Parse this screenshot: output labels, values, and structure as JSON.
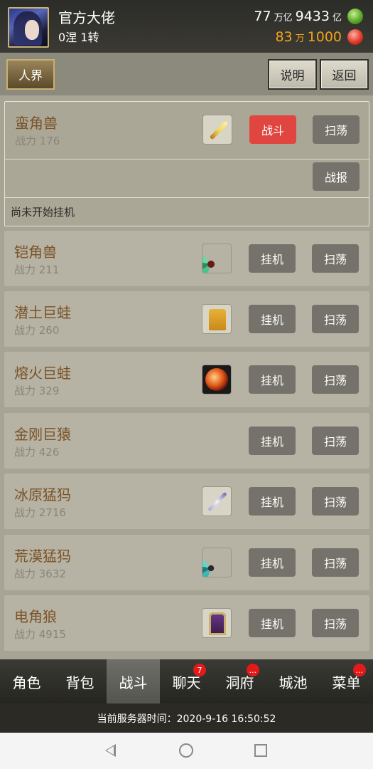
{
  "header": {
    "player_name": "官方大佬",
    "player_level": "0涅 1转",
    "currency_primary": {
      "amount_a": "77",
      "unit_a": "万亿",
      "amount_b": "9433",
      "unit_b": "亿",
      "gem": "green-gem-icon"
    },
    "currency_secondary": {
      "amount_a": "83",
      "unit_a": "万",
      "amount_b": "1000",
      "gem": "red-gem-icon"
    }
  },
  "toolbar": {
    "realm": "人界",
    "explain": "说明",
    "back": "返回"
  },
  "active_card": {
    "name": "蛮角兽",
    "power": "战力 176",
    "icon": "golden-sword-icon",
    "fight_label": "战斗",
    "sweep_label": "扫荡",
    "report_label": "战报",
    "status": "尚未开始挂机"
  },
  "monsters": [
    {
      "name": "铠角兽",
      "power": "战力 211",
      "icon": "green-fan-icon",
      "idle_label": "挂机",
      "sweep_label": "扫荡"
    },
    {
      "name": "潜土巨蛙",
      "power": "战力 260",
      "icon": "yellow-robe-icon",
      "idle_label": "挂机",
      "sweep_label": "扫荡"
    },
    {
      "name": "熔火巨蛙",
      "power": "战力 329",
      "icon": "fire-orb-icon",
      "idle_label": "挂机",
      "sweep_label": "扫荡"
    },
    {
      "name": "金刚巨猿",
      "power": "战力 426",
      "icon": "",
      "idle_label": "挂机",
      "sweep_label": "扫荡"
    },
    {
      "name": "冰原猛犸",
      "power": "战力 2716",
      "icon": "silver-blade-icon",
      "idle_label": "挂机",
      "sweep_label": "扫荡"
    },
    {
      "name": "荒漠猛犸",
      "power": "战力 3632",
      "icon": "teal-fan-icon",
      "idle_label": "挂机",
      "sweep_label": "扫荡"
    },
    {
      "name": "电角狼",
      "power": "战力 4915",
      "icon": "purple-armor-icon",
      "idle_label": "挂机",
      "sweep_label": "扫荡"
    }
  ],
  "navbar": {
    "items": [
      {
        "label": "角色",
        "badge": ""
      },
      {
        "label": "背包",
        "badge": ""
      },
      {
        "label": "战斗",
        "badge": "",
        "active": true
      },
      {
        "label": "聊天",
        "badge": "7"
      },
      {
        "label": "洞府",
        "badge": "..."
      },
      {
        "label": "城池",
        "badge": ""
      },
      {
        "label": "菜单",
        "badge": "..."
      }
    ]
  },
  "server_time": "当前服务器时间：2020-9-16 16:50:52",
  "colors": {
    "fight_button": "#e0463f",
    "action_button": "#74726a",
    "monster_name": "#7a5226",
    "currency_secondary": "#f2a21a",
    "badge": "#e21a1a"
  }
}
